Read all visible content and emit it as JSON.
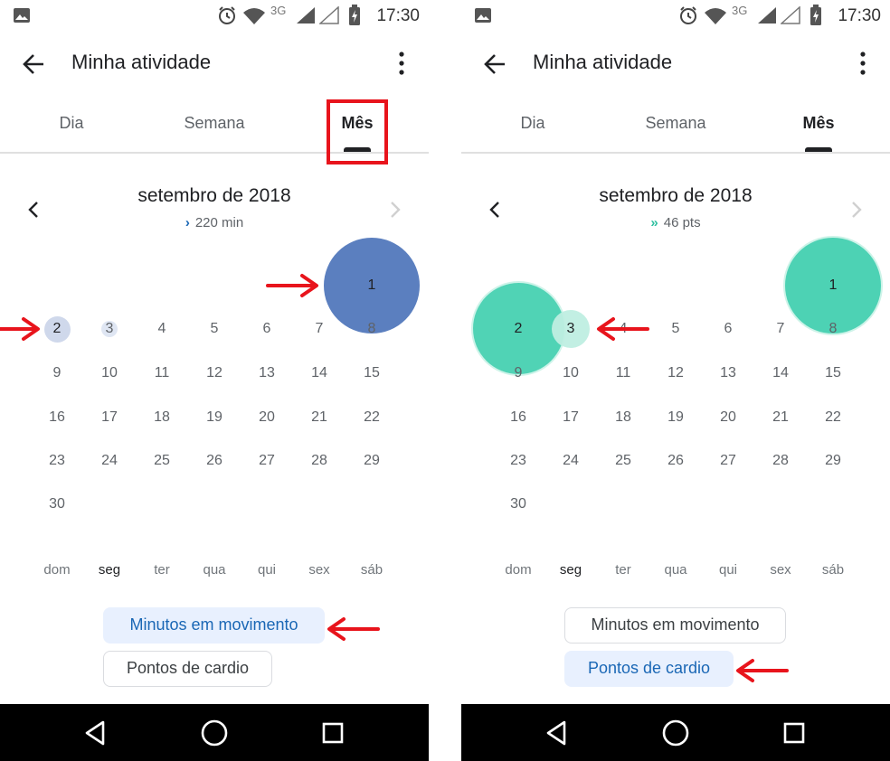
{
  "colors": {
    "accent_blue": "#5b7fbf",
    "accent_teal": "#3ecfae",
    "chip_selected_text": "#1a67b5",
    "chip_selected_bg": "#e8f0fe",
    "annotation_red": "#e8141c"
  },
  "status_bar": {
    "time": "17:30",
    "network": "3G",
    "icons": [
      "gallery-icon",
      "alarm-icon",
      "wifi-icon",
      "signal-icon",
      "signal-empty-icon",
      "battery-charging-icon"
    ]
  },
  "screens": [
    {
      "app_title": "Minha atividade",
      "tabs": [
        {
          "label": "Dia"
        },
        {
          "label": "Semana"
        },
        {
          "label": "Mês",
          "active": true
        }
      ],
      "month_title": "setembro de 2018",
      "summary_glyph": "›",
      "summary_text": "220 min",
      "summary_color": "#1a67b5",
      "weekdays": [
        "dom",
        "seg",
        "ter",
        "qua",
        "qui",
        "sex",
        "sáb"
      ],
      "chips": [
        {
          "label": "Minutos em movimento",
          "selected": true
        },
        {
          "label": "Pontos de cardio",
          "selected": false
        }
      ]
    },
    {
      "app_title": "Minha atividade",
      "tabs": [
        {
          "label": "Dia"
        },
        {
          "label": "Semana"
        },
        {
          "label": "Mês",
          "active": true
        }
      ],
      "month_title": "setembro de 2018",
      "summary_glyph": "»",
      "summary_text": "46 pts",
      "summary_color": "#2fbfa0",
      "weekdays": [
        "dom",
        "seg",
        "ter",
        "qua",
        "qui",
        "sex",
        "sáb"
      ],
      "chips": [
        {
          "label": "Minutos em movimento",
          "selected": false
        },
        {
          "label": "Pontos de cardio",
          "selected": true
        }
      ]
    }
  ]
}
